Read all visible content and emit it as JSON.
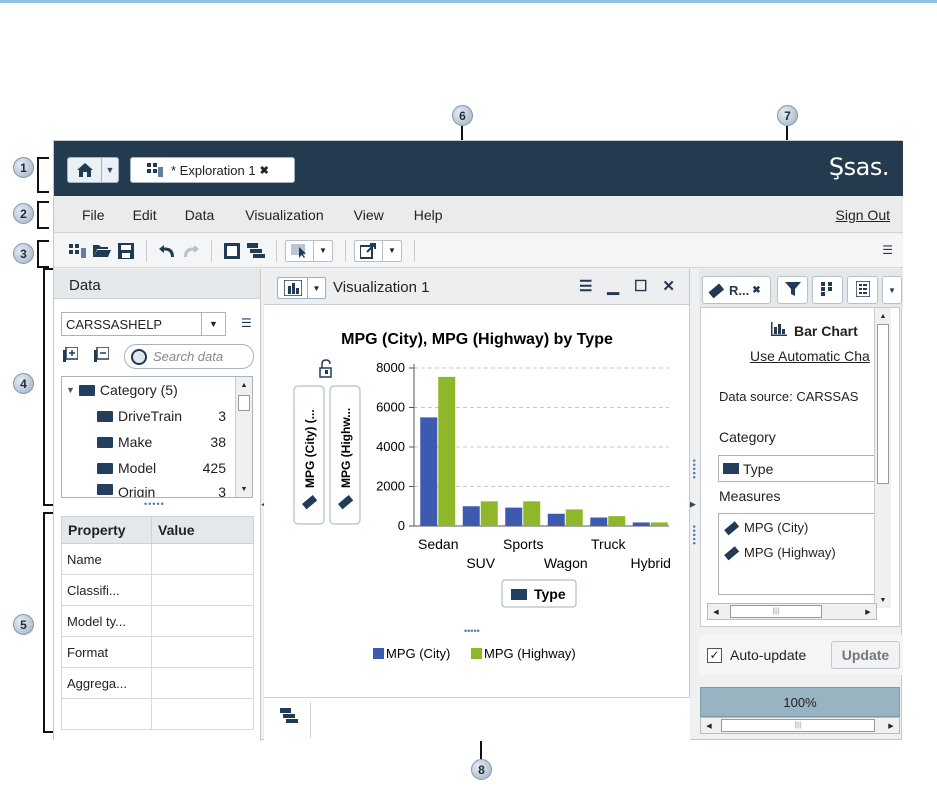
{
  "callouts": [
    "1",
    "2",
    "3",
    "4",
    "5",
    "6",
    "7",
    "8"
  ],
  "titlebar": {
    "tab_label": "* Exploration 1",
    "tab_close": "✖",
    "logo": "Şsas."
  },
  "menu": {
    "items": [
      "File",
      "Edit",
      "Data",
      "Visualization",
      "View",
      "Help"
    ],
    "sign_out": "Sign Out"
  },
  "data_pane": {
    "title": "Data",
    "data_source": "CARSSASHELP",
    "search_placeholder": "Search data",
    "tree": [
      {
        "label": "Category (5)",
        "count": ""
      },
      {
        "label": "DriveTrain",
        "count": "3"
      },
      {
        "label": "Make",
        "count": "38"
      },
      {
        "label": "Model",
        "count": "425"
      },
      {
        "label": "Origin",
        "count": "3"
      }
    ]
  },
  "properties": {
    "headers": [
      "Property",
      "Value"
    ],
    "rows": [
      "Name",
      "Classifi...",
      "Model ty...",
      "Format",
      "Aggrega...",
      ""
    ]
  },
  "visualization": {
    "tab_title": "Visualization 1",
    "role_buttons": [
      "MPG (City) (...",
      "MPG (Highw..."
    ],
    "group_button": "Type"
  },
  "chart_data": {
    "type": "bar",
    "title": "MPG (City), MPG (Highway) by Type",
    "categories": [
      "Sedan",
      "SUV",
      "Sports",
      "Wagon",
      "Truck",
      "Hybrid"
    ],
    "series": [
      {
        "name": "MPG (City)",
        "color": "#3d5ab0",
        "values": [
          5500,
          1000,
          930,
          620,
          430,
          180
        ]
      },
      {
        "name": "MPG (Highway)",
        "color": "#8fb72a",
        "values": [
          7550,
          1250,
          1250,
          840,
          500,
          180
        ]
      }
    ],
    "yticks": [
      "0",
      "2000",
      "4000",
      "6000",
      "8000"
    ],
    "ylim": [
      0,
      8000
    ],
    "grid": true,
    "legend": "bottom"
  },
  "right_pane": {
    "tab_label": "R...",
    "chart_type": "Bar Chart",
    "auto_chart_link": "Use Automatic Cha",
    "data_source_label": "Data source:  CARSSAS",
    "category_label": "Category",
    "category_value": "Type",
    "measures_label": "Measures",
    "measures": [
      "MPG (City)",
      "MPG (Highway)"
    ],
    "auto_update_label": "Auto-update",
    "auto_update_checked": "✓",
    "update_button": "Update",
    "zoom": "100%"
  }
}
